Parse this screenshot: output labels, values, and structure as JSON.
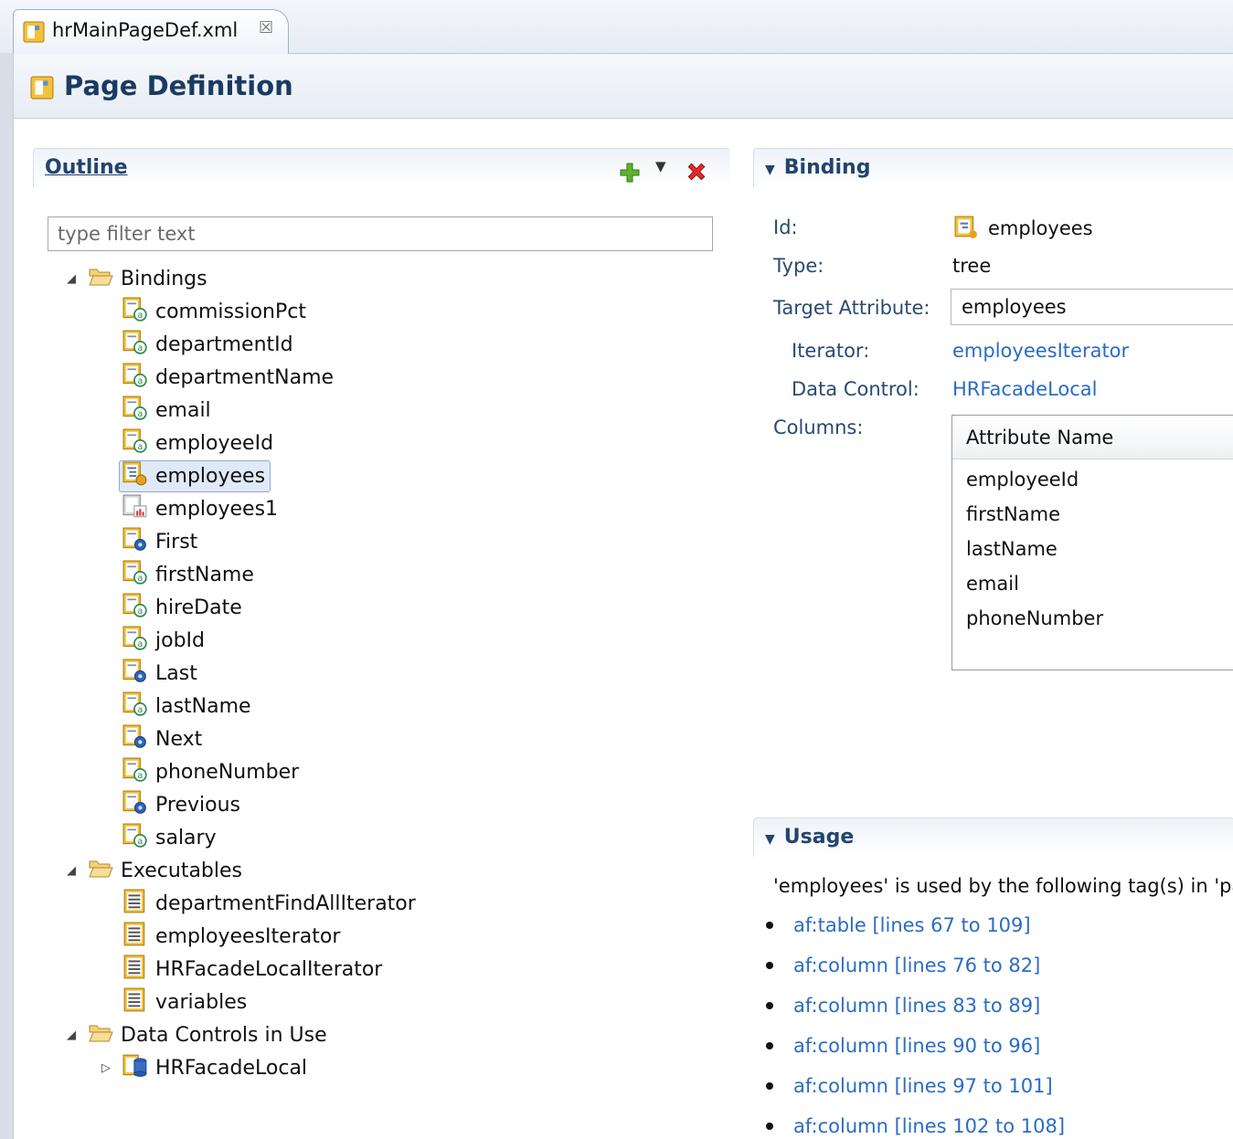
{
  "tab": {
    "title": "hrMainPageDef.xml",
    "close_glyph": "☒"
  },
  "header": {
    "title": "Page Definition"
  },
  "outline": {
    "title": "Outline",
    "filter_placeholder": "type filter text",
    "toolbar": {
      "add_icon": "add-icon",
      "dropdown_icon": "dropdown-icon",
      "delete_icon": "delete-icon"
    },
    "bindings_label": "Bindings",
    "bindings": [
      {
        "label": "commissionPct",
        "icon": "attribute-binding-icon"
      },
      {
        "label": "departmentId",
        "icon": "attribute-binding-icon"
      },
      {
        "label": "departmentName",
        "icon": "attribute-binding-icon"
      },
      {
        "label": "email",
        "icon": "attribute-binding-icon"
      },
      {
        "label": "employeeId",
        "icon": "attribute-binding-icon"
      },
      {
        "label": "employees",
        "icon": "tree-binding-icon",
        "selected": true
      },
      {
        "label": "employees1",
        "icon": "graph-binding-icon"
      },
      {
        "label": "First",
        "icon": "action-binding-icon"
      },
      {
        "label": "firstName",
        "icon": "attribute-binding-icon"
      },
      {
        "label": "hireDate",
        "icon": "attribute-binding-icon"
      },
      {
        "label": "jobId",
        "icon": "attribute-binding-icon"
      },
      {
        "label": "Last",
        "icon": "action-binding-icon"
      },
      {
        "label": "lastName",
        "icon": "attribute-binding-icon"
      },
      {
        "label": "Next",
        "icon": "action-binding-icon"
      },
      {
        "label": "phoneNumber",
        "icon": "attribute-binding-icon"
      },
      {
        "label": "Previous",
        "icon": "action-binding-icon"
      },
      {
        "label": "salary",
        "icon": "attribute-binding-icon"
      }
    ],
    "executables_label": "Executables",
    "executables": [
      {
        "label": "departmentFindAllIterator",
        "icon": "iterator-icon"
      },
      {
        "label": "employeesIterator",
        "icon": "iterator-icon"
      },
      {
        "label": "HRFacadeLocalIterator",
        "icon": "iterator-icon"
      },
      {
        "label": "variables",
        "icon": "iterator-icon"
      }
    ],
    "data_controls_label": "Data Controls in Use",
    "data_controls": [
      {
        "label": "HRFacadeLocal",
        "icon": "data-control-icon"
      }
    ]
  },
  "binding": {
    "title": "Binding",
    "id_label": "Id:",
    "id_value": "employees",
    "type_label": "Type:",
    "type_value": "tree",
    "target_label": "Target Attribute:",
    "target_value": "employees",
    "iterator_label": "Iterator:",
    "iterator_value": "employeesIterator",
    "datacontrol_label": "Data Control:",
    "datacontrol_value": "HRFacadeLocal",
    "columns_label": "Columns:",
    "columns_header": "Attribute Name",
    "columns": [
      "employeeId",
      "firstName",
      "lastName",
      "email",
      "phoneNumber"
    ]
  },
  "usage": {
    "title": "Usage",
    "description": "'employees' is used by the following tag(s) in 'pa",
    "items": [
      "af:table [lines 67 to 109]",
      "af:column [lines 76 to 82]",
      "af:column [lines 83 to 89]",
      "af:column [lines 90 to 96]",
      "af:column [lines 97 to 101]",
      "af:column [lines 102 to 108]"
    ]
  }
}
